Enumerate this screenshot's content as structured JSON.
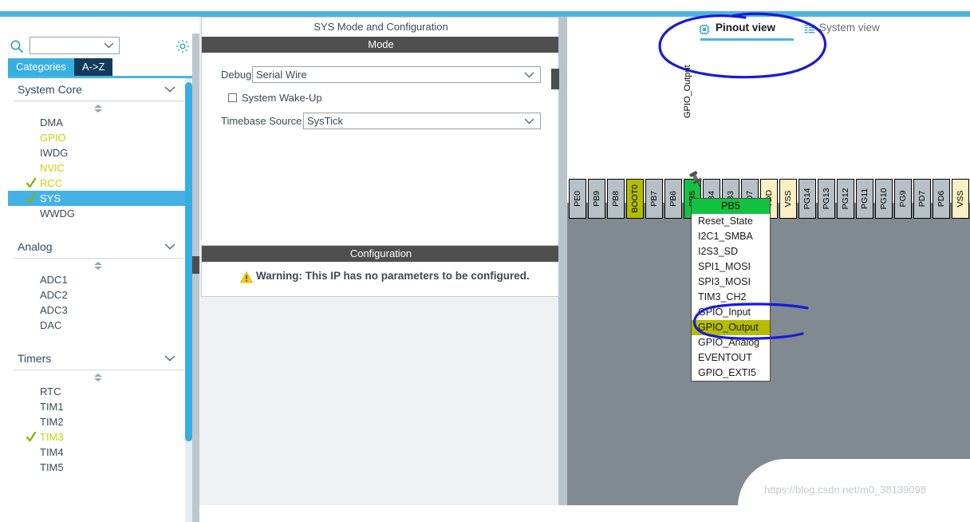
{
  "app": {
    "accent_color": "#4bb4e0",
    "watermark": "https://blog.csdn.net/m0_38139098"
  },
  "sidebar": {
    "search": {
      "value": "",
      "placeholder": "",
      "icon": "search-icon"
    },
    "settings_icon": "gear-icon",
    "tabs": [
      {
        "label": "Categories",
        "active": true
      },
      {
        "label": "A->Z",
        "active": false
      }
    ],
    "groups": [
      {
        "title": "System Core",
        "items": [
          {
            "label": "DMA",
            "checked": false,
            "enabled": false,
            "selected": false
          },
          {
            "label": "GPIO",
            "checked": false,
            "enabled": true,
            "selected": false
          },
          {
            "label": "IWDG",
            "checked": false,
            "enabled": false,
            "selected": false
          },
          {
            "label": "NVIC",
            "checked": false,
            "enabled": true,
            "selected": false
          },
          {
            "label": "RCC",
            "checked": true,
            "enabled": true,
            "selected": false
          },
          {
            "label": "SYS",
            "checked": true,
            "enabled": true,
            "selected": true
          },
          {
            "label": "WWDG",
            "checked": false,
            "enabled": false,
            "selected": false
          }
        ]
      },
      {
        "title": "Analog",
        "items": [
          {
            "label": "ADC1",
            "checked": false,
            "enabled": false,
            "selected": false
          },
          {
            "label": "ADC2",
            "checked": false,
            "enabled": false,
            "selected": false
          },
          {
            "label": "ADC3",
            "checked": false,
            "enabled": false,
            "selected": false
          },
          {
            "label": "DAC",
            "checked": false,
            "enabled": false,
            "selected": false
          }
        ]
      },
      {
        "title": "Timers",
        "items": [
          {
            "label": "RTC",
            "checked": false,
            "enabled": false,
            "selected": false
          },
          {
            "label": "TIM1",
            "checked": false,
            "enabled": false,
            "selected": false
          },
          {
            "label": "TIM2",
            "checked": false,
            "enabled": false,
            "selected": false
          },
          {
            "label": "TIM3",
            "checked": true,
            "enabled": true,
            "selected": false
          },
          {
            "label": "TIM4",
            "checked": false,
            "enabled": false,
            "selected": false
          },
          {
            "label": "TIM5",
            "checked": false,
            "enabled": false,
            "selected": false
          }
        ]
      }
    ]
  },
  "center": {
    "panel_title": "SYS Mode and Configuration",
    "mode": {
      "header": "Mode",
      "debug_label": "Debug",
      "debug_value": "Serial Wire",
      "wakeup_label": "System Wake-Up",
      "wakeup_checked": false,
      "timebase_label": "Timebase Source",
      "timebase_value": "SysTick"
    },
    "configuration": {
      "header": "Configuration",
      "warning_text": "Warning: This IP has no parameters to be configured.",
      "warning_icon": "warning-triangle-icon",
      "warning_color": "#ffcc00"
    }
  },
  "pinout": {
    "tabs": [
      {
        "label": "Pinout view",
        "icon": "chip-icon",
        "active": true
      },
      {
        "label": "System view",
        "icon": "list-icon",
        "active": false
      }
    ],
    "selected_pin": {
      "name": "PB5",
      "signal_label": "GPIO_Output",
      "header_color": "#13c243",
      "highlight_color": "#b5bd00",
      "options": [
        "Reset_State",
        "I2C1_SMBA",
        "I2S3_SD",
        "SPI1_MOSI",
        "SPI3_MOSI",
        "TIM3_CH2",
        "GPIO_Input",
        "GPIO_Output",
        "GPIO_Analog",
        "EVENTOUT",
        "GPIO_EXTI5"
      ],
      "selected_option": "GPIO_Output"
    },
    "pins": [
      {
        "label": "PE0",
        "kind": "io"
      },
      {
        "label": "PB9",
        "kind": "io"
      },
      {
        "label": "PB8",
        "kind": "io"
      },
      {
        "label": "BOOT0",
        "kind": "boot"
      },
      {
        "label": "PB7",
        "kind": "io"
      },
      {
        "label": "PB6",
        "kind": "io"
      },
      {
        "label": "PB5",
        "kind": "green"
      },
      {
        "label": "PB4",
        "kind": "io"
      },
      {
        "label": "PB3",
        "kind": "io"
      },
      {
        "label": "PD7",
        "kind": "io"
      },
      {
        "label": "VDD",
        "kind": "pwr"
      },
      {
        "label": "VSS",
        "kind": "pwr"
      },
      {
        "label": "PG14",
        "kind": "io"
      },
      {
        "label": "PG13",
        "kind": "io"
      },
      {
        "label": "PG12",
        "kind": "io"
      },
      {
        "label": "PG11",
        "kind": "io"
      },
      {
        "label": "PG10",
        "kind": "io"
      },
      {
        "label": "PG9",
        "kind": "io"
      },
      {
        "label": "PD7",
        "kind": "io"
      },
      {
        "label": "PD6",
        "kind": "io"
      },
      {
        "label": "VSS",
        "kind": "pwr"
      }
    ]
  }
}
